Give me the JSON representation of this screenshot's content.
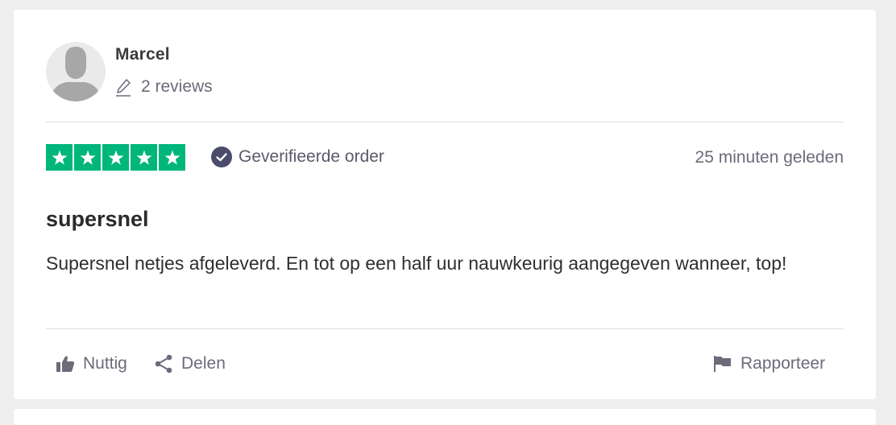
{
  "reviewer": {
    "name": "Marcel",
    "reviews_count": "2 reviews"
  },
  "rating": {
    "stars": 5,
    "max": 5,
    "color": "#00b67a"
  },
  "verified_label": "Geverifieerde order",
  "timestamp": "25 minuten geleden",
  "review": {
    "title": "supersnel",
    "body": "Supersnel netjes afgeleverd. En tot op een half uur nauwkeurig aangegeven wanneer, top!"
  },
  "actions": {
    "helpful": "Nuttig",
    "share": "Delen",
    "report": "Rapporteer"
  },
  "icons": {
    "avatar": "user-silhouette-icon",
    "reviews": "pencil-icon",
    "verified": "check-circle-icon",
    "helpful": "thumbs-up-icon",
    "share": "share-icon",
    "report": "flag-icon"
  }
}
